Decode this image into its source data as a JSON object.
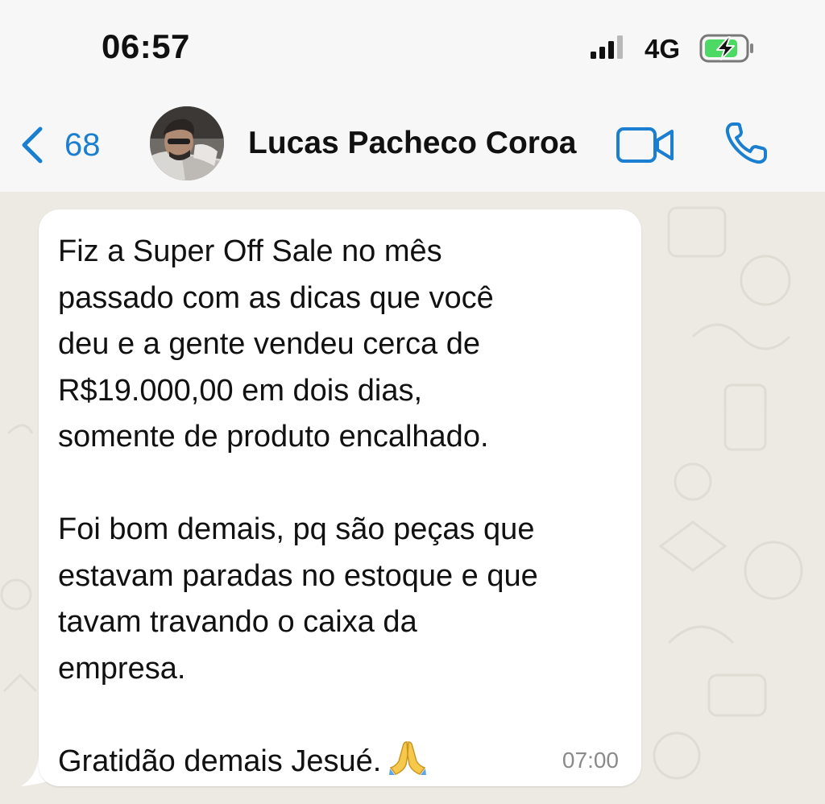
{
  "status_bar": {
    "time": "06:57",
    "network": "4G",
    "signal_icon": "signal-bars-icon",
    "battery_icon": "battery-charging-icon"
  },
  "header": {
    "back_icon": "chevron-left-icon",
    "back_count": "68",
    "contact_name": "Lucas Pacheco Coroa",
    "video_icon": "video-camera-icon",
    "call_icon": "phone-icon"
  },
  "message": {
    "paragraph_1": "Fiz a Super Off Sale no mês\npassado com as dicas que você\ndeu e a gente vendeu cerca de\nR$19.000,00 em dois dias,\nsomente de produto encalhado.",
    "paragraph_2": "Foi bom demais, pq são peças que\nestavam paradas no estoque e que\ntavam travando o caixa da\nempresa.",
    "paragraph_3": "Gratidão demais Jesué.",
    "emoji_icon": "folded-hands-emoji-icon",
    "time": "07:00"
  },
  "colors": {
    "accent": "#1a7fd0",
    "chat_background": "#eceae3",
    "bubble": "#ffffff",
    "header_background": "#f7f7f7",
    "battery_fill": "#4cd964"
  }
}
